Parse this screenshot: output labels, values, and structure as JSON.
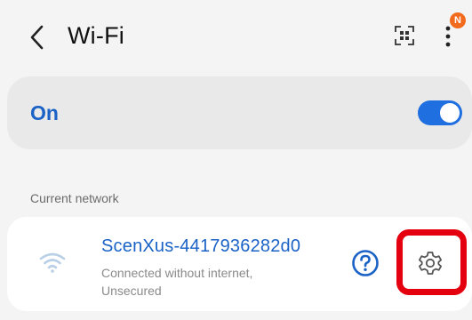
{
  "header": {
    "title": "Wi-Fi",
    "back_icon": "chevron-left-icon",
    "qr_icon": "qr-scan-icon",
    "more_icon": "more-vertical-icon",
    "notification_badge": "N",
    "badge_color": "#f26b1d"
  },
  "toggle": {
    "label": "On",
    "state": "on",
    "accent_color": "#1f6fe0"
  },
  "current_network": {
    "section_label": "Current network",
    "name": "ScenXus-4417936282d0",
    "status": "Connected without internet, Unsecured",
    "wifi_icon": "wifi-icon",
    "help_icon": "help-icon",
    "settings_icon": "gear-icon",
    "highlight_color": "#e4000f"
  }
}
